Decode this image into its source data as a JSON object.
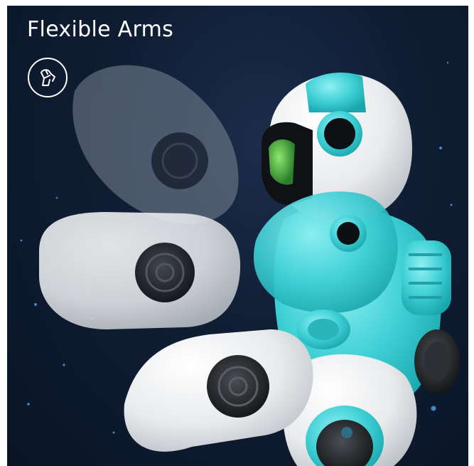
{
  "feature": {
    "title": "Flexible Arms",
    "icon": "robot-arm-icon"
  },
  "colors": {
    "background": "#0f1d33",
    "accent": "#3fd0d6",
    "shell": "#f2f3f4",
    "text": "#ffffff"
  }
}
